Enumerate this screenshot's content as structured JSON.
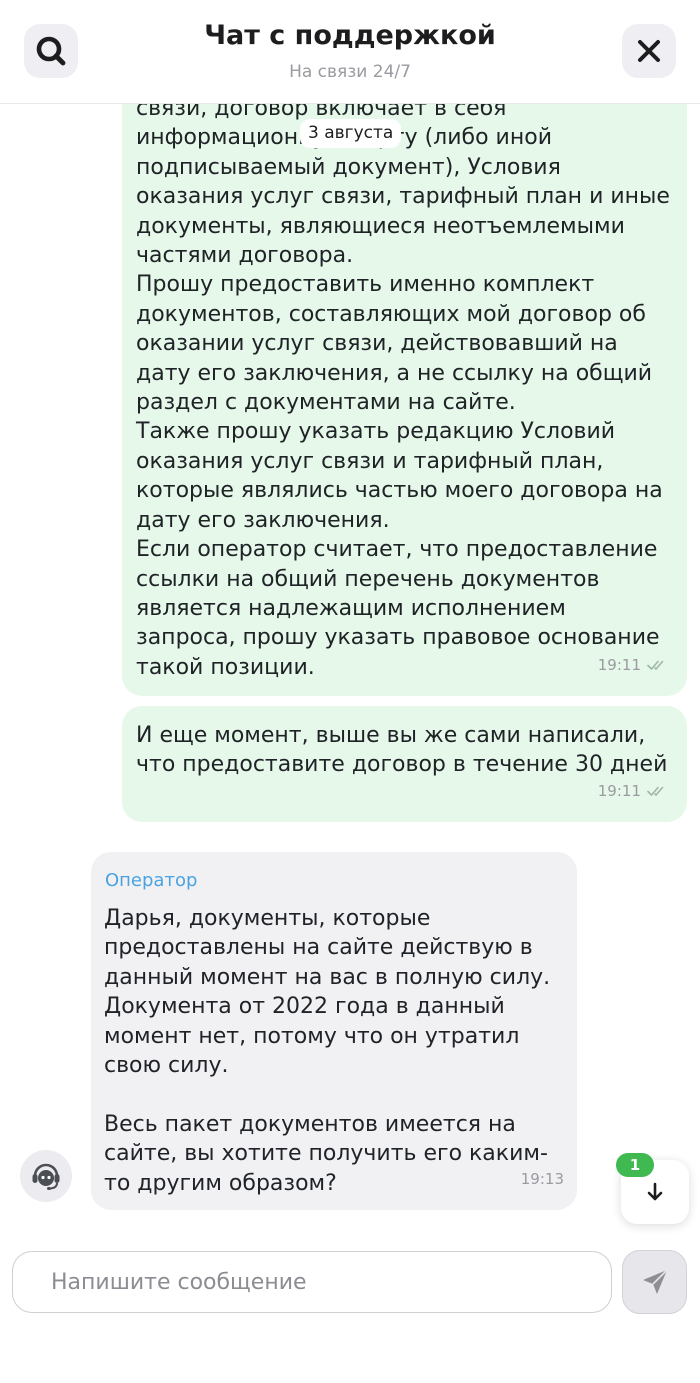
{
  "header": {
    "title": "Чат с поддержкой",
    "subtitle": "На связи 24/7",
    "search_icon": "search-icon",
    "close_icon": "close-icon"
  },
  "date_divider": "3 августа",
  "messages": [
    {
      "author": "user",
      "text": "связи, договор включает в себя\nинформационную карту (либо иной\nподписываемый документ), Условия\nоказания услуг связи, тарифный план и иные\nдокументы, являющиеся неотъемлемыми\nчастями договора.\nПрошу предоставить именно комплект\nдокументов, составляющих мой договор об\nоказании услуг связи, действовавший на\nдату его заключения, а не ссылку на общий\nраздел с документами на сайте.\nТакже прошу указать редакцию Условий\nоказания услуг связи и тарифный план,\nкоторые являлись частью моего договора на\nдату его заключения.\nЕсли оператор считает, что предоставление\nссылки на общий перечень документов\nявляется надлежащим исполнением\nзапроса, прошу указать правовое основание\nтакой позиции.",
      "time": "19:11",
      "status_icon": "double-check-icon"
    },
    {
      "author": "user",
      "text": "И еще момент, выше вы же сами написали,\nчто предоставите договор в течение 30 дней",
      "time": "19:11",
      "status_icon": "double-check-icon"
    },
    {
      "author": "operator",
      "name": "Оператор",
      "text": "Дарья, документы, которые\nпредоставлены на сайте действую в\nданный момент на вас в полную силу.\nДокумента от 2022 года в данный\nмомент нет, потому что он утратил\nсвою силу.\n\nВесь пакет документов имеется на\nсайте, вы хотите получить его каким-\nто другим образом?",
      "time": "19:13"
    }
  ],
  "scroll_down": {
    "unread_count": "1",
    "icon": "arrow-down-icon"
  },
  "composer": {
    "placeholder": "Напишите сообщение",
    "value": "",
    "send_icon": "send-icon"
  },
  "colors": {
    "user_bubble": "#e5f8e9",
    "operator_bubble": "#f1f1f4",
    "operator_name": "#4aa3e0",
    "badge": "#3fb950"
  }
}
